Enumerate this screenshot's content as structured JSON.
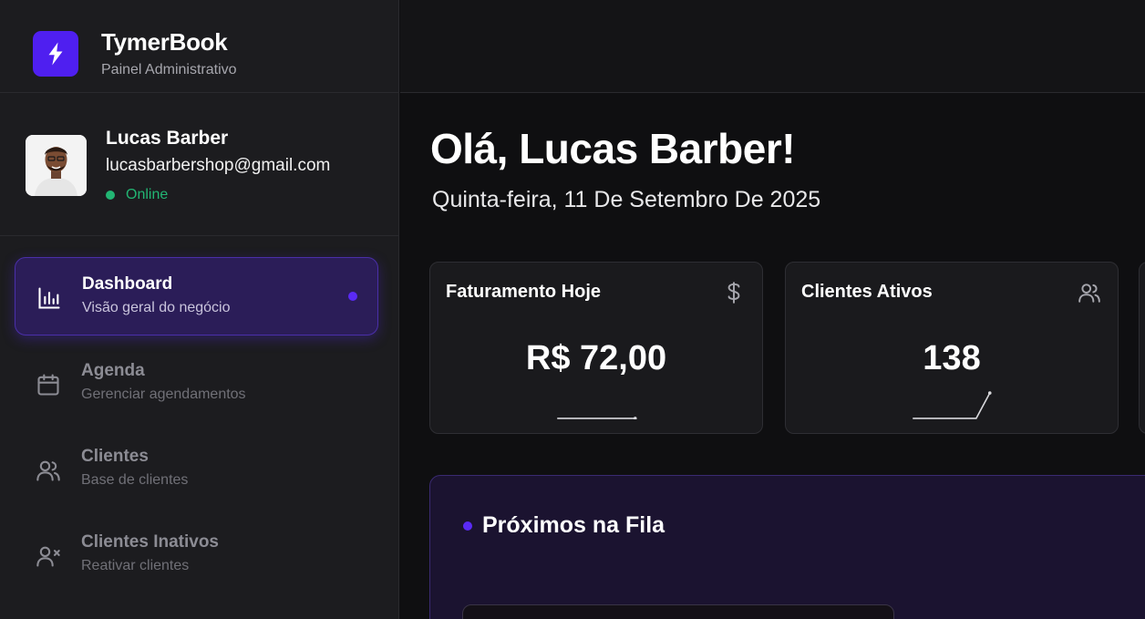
{
  "brand": {
    "name": "TymerBook",
    "subtitle": "Painel Administrativo",
    "logo_icon": "lightning-bolt-icon",
    "accent": "#4f1ff0"
  },
  "profile": {
    "name": "Lucas Barber",
    "email": "lucasbarbershop@gmail.com",
    "status": "Online",
    "status_color": "#22b573"
  },
  "nav": {
    "items": [
      {
        "title": "Dashboard",
        "subtitle": "Visão geral do negócio",
        "icon": "bar-chart-icon",
        "active": true
      },
      {
        "title": "Agenda",
        "subtitle": "Gerenciar agendamentos",
        "icon": "calendar-icon",
        "active": false
      },
      {
        "title": "Clientes",
        "subtitle": "Base de clientes",
        "icon": "users-icon",
        "active": false
      },
      {
        "title": "Clientes Inativos",
        "subtitle": "Reativar clientes",
        "icon": "user-x-icon",
        "active": false
      }
    ]
  },
  "main": {
    "greeting": "Olá, Lucas Barber!",
    "date": "Quinta-feira, 11 De Setembro De 2025",
    "stats": [
      {
        "title": "Faturamento Hoje",
        "value": "R$ 72,00",
        "icon": "dollar-icon"
      },
      {
        "title": "Clientes Ativos",
        "value": "138",
        "icon": "users-icon"
      }
    ],
    "queue": {
      "title": "Próximos na Fila"
    }
  }
}
